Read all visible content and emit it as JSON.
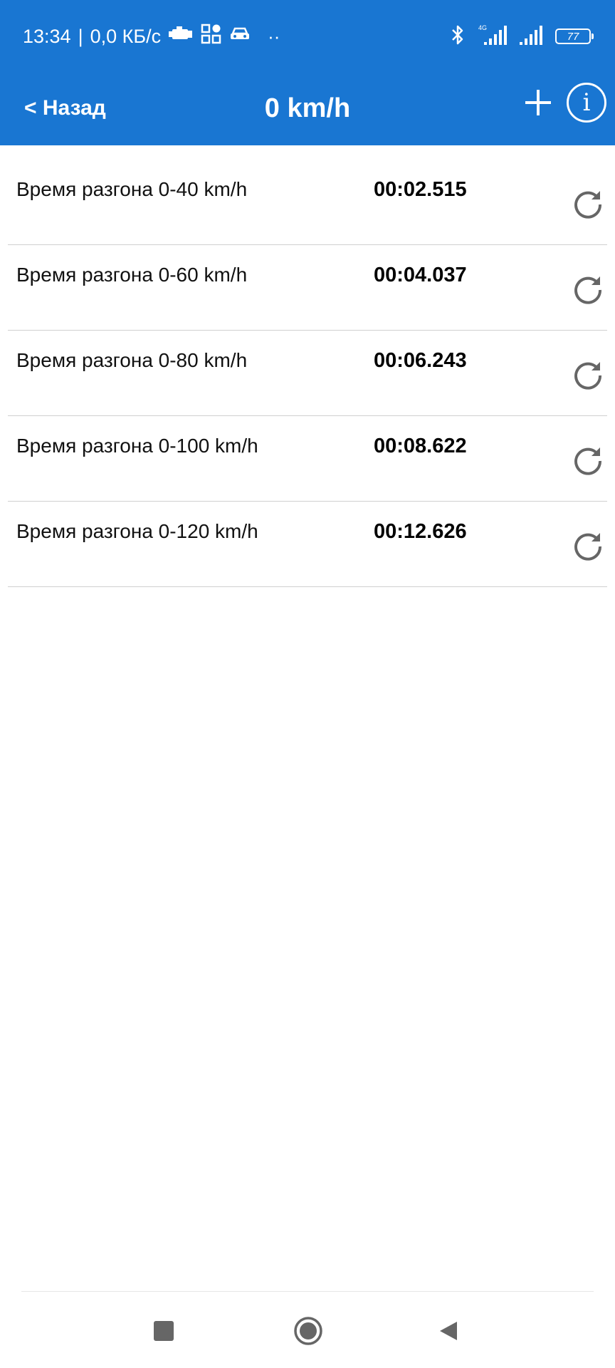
{
  "status_bar": {
    "time": "13:34",
    "separator": "|",
    "data_rate": "0,0 КБ/с",
    "overflow_dots": "··",
    "battery_level": "77"
  },
  "header": {
    "back_label": "< Назад",
    "title": "0 km/h",
    "info_glyph": "i"
  },
  "results": [
    {
      "label": "Время разгона  0-40 km/h",
      "time": "00:02.515"
    },
    {
      "label": "Время разгона  0-60 km/h",
      "time": "00:04.037"
    },
    {
      "label": "Время разгона  0-80 km/h",
      "time": "00:06.243"
    },
    {
      "label": "Время разгона  0-100 km/h",
      "time": "00:08.622"
    },
    {
      "label": "Время разгона  0-120 km/h",
      "time": "00:12.626"
    }
  ],
  "colors": {
    "app_bar": "#1976d2",
    "icon_gray": "#666666",
    "divider": "#cfcfcf"
  },
  "icons": {
    "status": [
      "check-engine-icon",
      "apps-grid-icon",
      "car-icon",
      "bluetooth-icon",
      "signal-4g-icon",
      "signal-icon",
      "battery-icon"
    ],
    "header": [
      "plus-icon",
      "info-icon"
    ],
    "row_action": "refresh-icon",
    "system_nav": [
      "recents-square-icon",
      "home-circle-icon",
      "back-triangle-icon"
    ]
  }
}
